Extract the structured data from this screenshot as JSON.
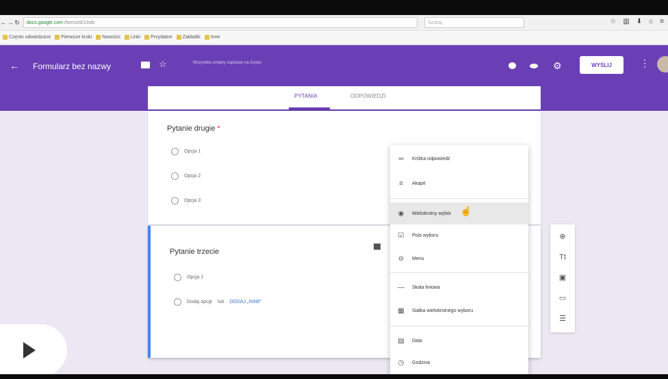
{
  "browser": {
    "url_host": "docs.google.com",
    "url_path": "/forms/d/1/edit",
    "search_placeholder": "Szukaj"
  },
  "bookmarks": [
    {
      "label": "Często odwiedzane"
    },
    {
      "label": "Pierwsze kroki"
    },
    {
      "label": "Nowości"
    },
    {
      "label": "Linki"
    },
    {
      "label": "Przydatne"
    },
    {
      "label": "Zakładki"
    },
    {
      "label": "Inne"
    }
  ],
  "header": {
    "title": "Formularz bez nazwy",
    "saved_note": "Wszystkie zmiany zapisane na Dysku",
    "send_label": "WYŚLIJ",
    "accent_color": "#6a3fb5"
  },
  "tabs": {
    "questions": "PYTANIA",
    "answers": "ODPOWIEDZI"
  },
  "card1": {
    "title": "Pytanie drugie",
    "required_mark": "*",
    "options": [
      "Opcja 1",
      "Opcja 2",
      "Opcja 3"
    ]
  },
  "card2": {
    "title": "Pytanie trzecie",
    "option1": "Opcja 1",
    "add_option": "Dodaj opcję",
    "add_other_prefix": "lub",
    "add_other_link": "DODAJ „INNE”"
  },
  "menu": {
    "items": [
      {
        "label": "Krótka odpowiedź",
        "icon": "short-answer-icon"
      },
      {
        "label": "Akapit",
        "icon": "paragraph-icon"
      },
      {
        "label": "Wielokrotny wybór",
        "icon": "radio-icon"
      },
      {
        "label": "Pola wyboru",
        "icon": "checkbox-icon"
      },
      {
        "label": "Menu",
        "icon": "dropdown-icon"
      },
      {
        "label": "Skala liniowa",
        "icon": "linear-scale-icon"
      },
      {
        "label": "Siatka wielokrotnego wyboru",
        "icon": "grid-icon"
      },
      {
        "label": "Data",
        "icon": "calendar-icon"
      },
      {
        "label": "Godzina",
        "icon": "clock-icon"
      }
    ]
  },
  "toolbar": {
    "icons": [
      "add-question-icon",
      "add-title-icon",
      "add-image-icon",
      "add-video-icon",
      "add-section-icon"
    ]
  }
}
